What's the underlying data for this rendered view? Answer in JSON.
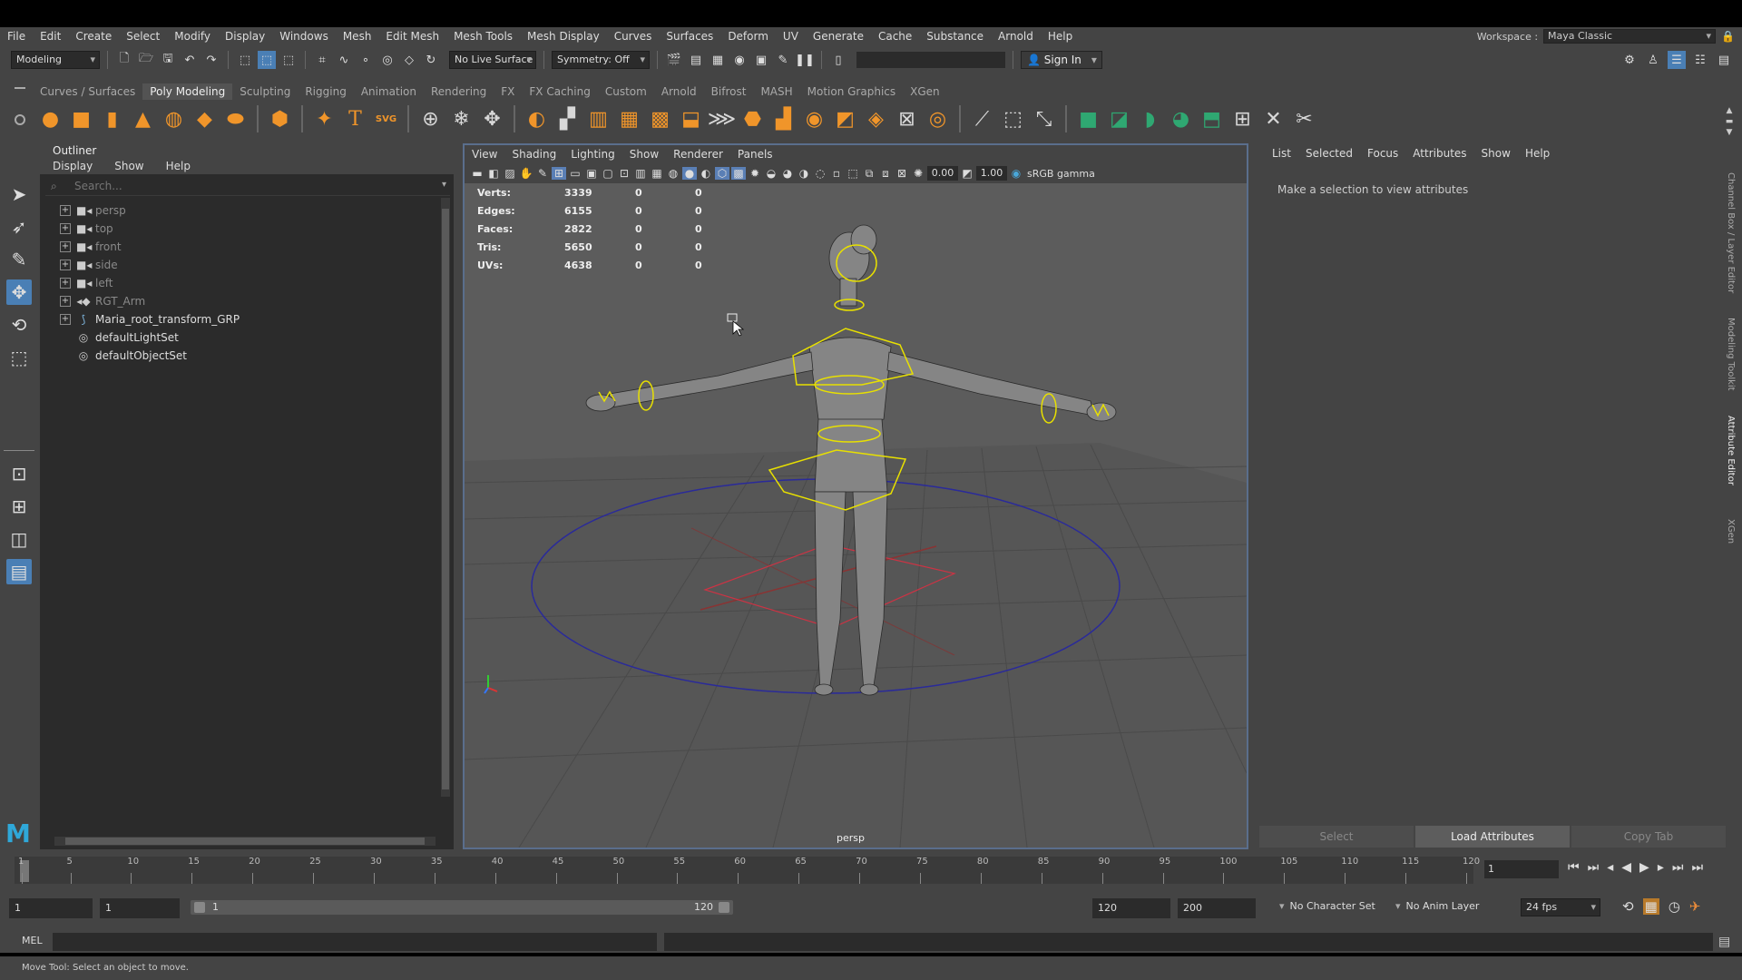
{
  "menubar": {
    "items": [
      "File",
      "Edit",
      "Create",
      "Select",
      "Modify",
      "Display",
      "Windows",
      "Mesh",
      "Edit Mesh",
      "Mesh Tools",
      "Mesh Display",
      "Curves",
      "Surfaces",
      "Deform",
      "UV",
      "Generate",
      "Cache",
      "Substance",
      "Arnold",
      "Help"
    ],
    "workspace_label": "Workspace :",
    "workspace_value": "Maya Classic"
  },
  "statusline": {
    "mode": "Modeling",
    "live_surface": "No Live Surface",
    "symmetry": "Symmetry: Off",
    "sign_in": "Sign In"
  },
  "shelf": {
    "tabs": [
      "Curves / Surfaces",
      "Poly Modeling",
      "Sculpting",
      "Rigging",
      "Animation",
      "Rendering",
      "FX",
      "FX Caching",
      "Custom",
      "Arnold",
      "Bifrost",
      "MASH",
      "Motion Graphics",
      "XGen"
    ],
    "active_tab": "Poly Modeling"
  },
  "outliner": {
    "title": "Outliner",
    "menu": [
      "Display",
      "Show",
      "Help"
    ],
    "search_placeholder": "Search...",
    "items": [
      {
        "label": "persp",
        "icon": "camera-icon",
        "dim": true,
        "expandable": true
      },
      {
        "label": "top",
        "icon": "camera-icon",
        "dim": true,
        "expandable": true
      },
      {
        "label": "front",
        "icon": "camera-icon",
        "dim": true,
        "expandable": true
      },
      {
        "label": "side",
        "icon": "camera-icon",
        "dim": true,
        "expandable": true
      },
      {
        "label": "left",
        "icon": "camera-icon",
        "dim": true,
        "expandable": true
      },
      {
        "label": "RGT_Arm",
        "icon": "joint-icon",
        "dim": true,
        "expandable": true
      },
      {
        "label": "Maria_root_transform_GRP",
        "icon": "curve-icon",
        "dim": false,
        "expandable": true
      },
      {
        "label": "defaultLightSet",
        "icon": "set-icon",
        "dim": false,
        "expandable": false
      },
      {
        "label": "defaultObjectSet",
        "icon": "set-icon",
        "dim": false,
        "expandable": false
      }
    ]
  },
  "viewport": {
    "menu": [
      "View",
      "Shading",
      "Lighting",
      "Show",
      "Renderer",
      "Panels"
    ],
    "exposure": "0.00",
    "gamma": "1.00",
    "color_space": "sRGB gamma",
    "hud": [
      {
        "label": "Verts:",
        "v1": "3339",
        "v2": "0",
        "v3": "0"
      },
      {
        "label": "Edges:",
        "v1": "6155",
        "v2": "0",
        "v3": "0"
      },
      {
        "label": "Faces:",
        "v1": "2822",
        "v2": "0",
        "v3": "0"
      },
      {
        "label": "Tris:",
        "v1": "5650",
        "v2": "0",
        "v3": "0"
      },
      {
        "label": "UVs:",
        "v1": "4638",
        "v2": "0",
        "v3": "0"
      }
    ],
    "camera_label": "persp"
  },
  "attribute_editor": {
    "menu": [
      "List",
      "Selected",
      "Focus",
      "Attributes",
      "Show",
      "Help"
    ],
    "message": "Make a selection to view attributes",
    "buttons": [
      "Select",
      "Load Attributes",
      "Copy Tab"
    ]
  },
  "side_tabs": [
    "Channel Box / Layer Editor",
    "Modeling Toolkit",
    "Attribute Editor",
    "XGen"
  ],
  "timeline": {
    "ticks": [
      "1",
      "5",
      "10",
      "15",
      "20",
      "25",
      "30",
      "35",
      "40",
      "45",
      "50",
      "55",
      "60",
      "65",
      "70",
      "75",
      "80",
      "85",
      "90",
      "95",
      "100",
      "105",
      "110",
      "115",
      "120"
    ],
    "current_frame": "1"
  },
  "range": {
    "start": "1",
    "anim_start": "1",
    "range_start": "1",
    "range_end": "120",
    "end": "120",
    "anim_end": "200",
    "character_set": "No Character Set",
    "anim_layer": "No Anim Layer",
    "fps": "24 fps"
  },
  "command": {
    "language": "MEL"
  },
  "helpline": "Move Tool: Select an object to move.",
  "colors": {
    "shelf_orange": "#f0952a",
    "shelf_green": "#2fa872",
    "active_tool": "#4a7fb5",
    "rig_yellow": "#e8e000",
    "ground_circle": "#2a2a9a"
  }
}
